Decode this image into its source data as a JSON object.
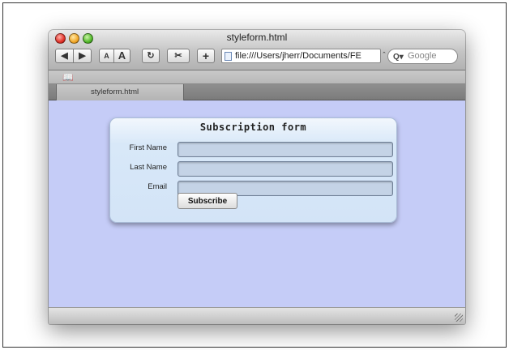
{
  "window": {
    "title": "styleform.html"
  },
  "toolbar": {
    "back_glyph": "◀",
    "forward_glyph": "▶",
    "text_smaller_label": "A",
    "text_bigger_label": "A",
    "reload_glyph": "↻",
    "snippet_glyph": "✂",
    "add_bookmark_glyph": "+",
    "url": "file:///Users/jherr/Documents/FE",
    "url_menu_glyph": "⌃",
    "search_placeholder": "Google",
    "search_glyph": "Q▾"
  },
  "bookmarks_bar": {
    "book_glyph": "📖"
  },
  "tabs": [
    {
      "label": "styleform.html"
    }
  ],
  "form": {
    "title": "Subscription form",
    "fields": [
      {
        "label": "First Name",
        "value": ""
      },
      {
        "label": "Last Name",
        "value": ""
      },
      {
        "label": "Email",
        "value": ""
      }
    ],
    "submit_label": "Subscribe"
  },
  "colors": {
    "page_background": "#c5ccf7",
    "card_background": "#d3e4f7",
    "input_background": "#c4d3e6"
  },
  "icons": {
    "close": "close-icon",
    "minimize": "minimize-icon",
    "zoom": "zoom-icon",
    "page": "page-icon",
    "bookmarks": "book-icon",
    "resize": "resize-grip-icon"
  }
}
